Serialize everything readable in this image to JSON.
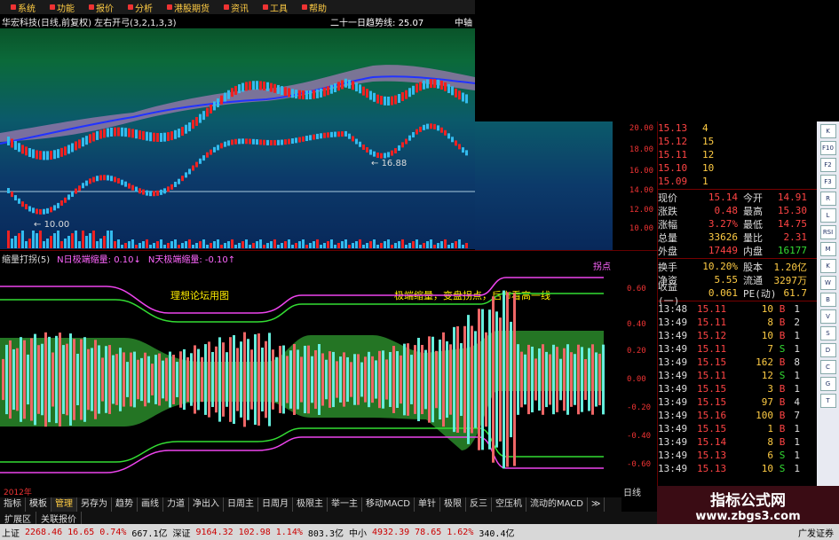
{
  "menu": {
    "items": [
      "系统",
      "功能",
      "报价",
      "分析",
      "港股期货",
      "资讯",
      "工具",
      "帮助"
    ]
  },
  "main_chart": {
    "title": "华宏科技(日线,前复权) 左右开弓(3,2,1,3,3)",
    "trend_label": "二十一日趋势线:",
    "trend_value": "25.07",
    "right_tag": "中轴",
    "annotation_high": "16.88",
    "annotation_low": "10.00",
    "axis_labels": [
      "20.00",
      "18.00",
      "16.00",
      "14.00",
      "12.00",
      "10.00"
    ]
  },
  "lower_chart": {
    "name": "缩量打拐(5)",
    "n1": "N日极端缩量: 0.10↓",
    "n2": "N天极端缩量: -0.10↑",
    "tag": "拐点",
    "note1": "理想论坛用图",
    "note2": "极端缩量，变盘拐点，后市看高一线",
    "axis_labels": [
      "0.60",
      "0.40",
      "0.20",
      "0.00",
      "-0.20",
      "-0.40",
      "-0.60"
    ]
  },
  "quote": {
    "asks": [
      {
        "price": "15.13",
        "vol": "4"
      },
      {
        "price": "15.12",
        "vol": "15"
      },
      {
        "price": "15.11",
        "vol": "12"
      },
      {
        "price": "15.10",
        "vol": "10"
      },
      {
        "price": "15.09",
        "vol": "1"
      }
    ],
    "stats": [
      {
        "k1": "现价",
        "v1": "15.14",
        "k2": "今开",
        "v2": "14.91",
        "g2": false
      },
      {
        "k1": "涨跌",
        "v1": "0.48",
        "k2": "最高",
        "v2": "15.30",
        "g2": false
      },
      {
        "k1": "涨幅",
        "v1": "3.27%",
        "k2": "最低",
        "v2": "14.75",
        "g2": false
      },
      {
        "k1": "总量",
        "v1": "33626",
        "k2": "量比",
        "v2": "2.31",
        "g2": false
      },
      {
        "k1": "外盘",
        "v1": "17449",
        "k2": "内盘",
        "v2": "16177",
        "g2": true
      }
    ],
    "stats2": [
      {
        "k1": "换手",
        "v1": "10.20%",
        "k2": "股本",
        "v2": "1.20亿"
      },
      {
        "k1": "净资",
        "v1": "5.55",
        "k2": "流通",
        "v2": "3297万"
      },
      {
        "k1": "收益(一)",
        "v1": "0.061",
        "k2": "PE(动)",
        "v2": "61.7"
      }
    ],
    "ticks": [
      {
        "t": "13:48",
        "p": "15.11",
        "v": "10",
        "f": "B",
        "n": "1"
      },
      {
        "t": "13:49",
        "p": "15.11",
        "v": "8",
        "f": "B",
        "n": "2"
      },
      {
        "t": "13:49",
        "p": "15.12",
        "v": "10",
        "f": "B",
        "n": "1"
      },
      {
        "t": "13:49",
        "p": "15.11",
        "v": "7",
        "f": "S",
        "n": "1"
      },
      {
        "t": "13:49",
        "p": "15.15",
        "v": "162",
        "f": "B",
        "n": "8"
      },
      {
        "t": "13:49",
        "p": "15.11",
        "v": "12",
        "f": "S",
        "n": "1"
      },
      {
        "t": "13:49",
        "p": "15.15",
        "v": "3",
        "f": "B",
        "n": "1"
      },
      {
        "t": "13:49",
        "p": "15.15",
        "v": "97",
        "f": "B",
        "n": "4"
      },
      {
        "t": "13:49",
        "p": "15.16",
        "v": "100",
        "f": "B",
        "n": "7"
      },
      {
        "t": "13:49",
        "p": "15.15",
        "v": "1",
        "f": "B",
        "n": "1"
      },
      {
        "t": "13:49",
        "p": "15.14",
        "v": "8",
        "f": "B",
        "n": "1"
      },
      {
        "t": "13:49",
        "p": "15.13",
        "v": "6",
        "f": "S",
        "n": "1"
      },
      {
        "t": "13:49",
        "p": "15.13",
        "v": "10",
        "f": "S",
        "n": "1"
      }
    ]
  },
  "side_icons": [
    "K",
    "F10",
    "F2",
    "F3",
    "R",
    "L",
    "RSI",
    "M",
    "K",
    "W",
    "B",
    "V",
    "S",
    "D",
    "C",
    "G",
    "T"
  ],
  "tabs": [
    "指标",
    "模板",
    "管理",
    "另存为",
    "趋势",
    "画线",
    "力道",
    "净出入",
    "日周主",
    "日周月",
    "极限主",
    "举一主",
    "移动MACD",
    "单针",
    "极限",
    "反三",
    "空压机",
    "流动的MACD",
    "≫"
  ],
  "tabs2": [
    "扩展区",
    "关联报价"
  ],
  "date_axis": "2012年",
  "period": "日线",
  "statusbar": {
    "sh_label": "上证",
    "sh_value": "2268.46",
    "sh_change": "16.65",
    "sh_pct": "0.74%",
    "sh_amount": "667.1亿",
    "sz_label": "深证",
    "sz_value": "9164.32",
    "sz_change": "102.98",
    "sz_pct": "1.14%",
    "sz_amount": "803.3亿",
    "zx_label": "中小",
    "zx_value": "4932.39",
    "zx_change": "78.65",
    "zx_pct": "1.62%",
    "zx_amount": "340.4亿",
    "broker": "广发证券"
  },
  "watermark": {
    "title": "指标公式网",
    "url": "www.zbgs3.com"
  }
}
